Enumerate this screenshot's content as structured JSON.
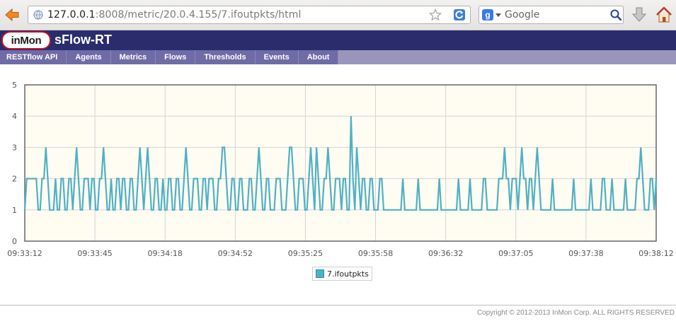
{
  "browser": {
    "url_host": "127.0.0.1",
    "url_rest": ":8008/metric/20.0.4.155/7.ifoutpkts/html",
    "search_placeholder": "Google",
    "icons": [
      "back-arrow-icon",
      "globe-icon",
      "star-icon",
      "reload-icon",
      "google-icon",
      "search-icon",
      "download-icon",
      "home-icon"
    ]
  },
  "app": {
    "logo_text": "inMon",
    "title": "sFlow-RT",
    "brand_color": "#2a2c6b",
    "logo_ring_color": "#c0102a"
  },
  "nav": {
    "tabs": [
      "RESTflow API",
      "Agents",
      "Metrics",
      "Flows",
      "Thresholds",
      "Events",
      "About"
    ]
  },
  "chart_data": {
    "type": "line",
    "title": "",
    "xlabel": "",
    "ylabel": "",
    "ylim": [
      0,
      5
    ],
    "yticks": [
      0,
      1,
      2,
      3,
      4,
      5
    ],
    "xticks": [
      "09:33:12",
      "09:33:45",
      "09:34:18",
      "09:34:52",
      "09:35:25",
      "09:35:58",
      "09:36:32",
      "09:37:05",
      "09:37:38",
      "09:38:12"
    ],
    "grid": true,
    "legend_position": "bottom",
    "plot_background": "#fffcf2",
    "series": [
      {
        "name": "7.ifoutpkts",
        "color": "#4fb1c4",
        "values": [
          1,
          2,
          2,
          2,
          2,
          2,
          2,
          1,
          1,
          2,
          2,
          3,
          2,
          1,
          1,
          1,
          2,
          1,
          1,
          2,
          2,
          1,
          1,
          2,
          2,
          1,
          2,
          3,
          2,
          1,
          1,
          2,
          2,
          2,
          1,
          2,
          2,
          1,
          1,
          2,
          2,
          3,
          2,
          1,
          1,
          2,
          1,
          1,
          2,
          2,
          1,
          2,
          2,
          1,
          1,
          2,
          2,
          1,
          1,
          2,
          3,
          2,
          1,
          2,
          3,
          2,
          1,
          1,
          2,
          2,
          1,
          1,
          2,
          1,
          1,
          2,
          2,
          1,
          1,
          2,
          2,
          1,
          1,
          2,
          3,
          2,
          1,
          1,
          2,
          2,
          2,
          1,
          1,
          2,
          2,
          1,
          2,
          2,
          2,
          1,
          1,
          2,
          2,
          3,
          3,
          2,
          1,
          1,
          2,
          2,
          1,
          1,
          2,
          2,
          1,
          1,
          1,
          2,
          2,
          1,
          1,
          2,
          3,
          2,
          1,
          1,
          2,
          2,
          1,
          1,
          1,
          2,
          2,
          2,
          1,
          1,
          1,
          2,
          3,
          3,
          2,
          1,
          1,
          2,
          2,
          2,
          1,
          1,
          2,
          3,
          2,
          1,
          3,
          2,
          1,
          1,
          2,
          2,
          3,
          2,
          1,
          1,
          2,
          2,
          2,
          1,
          2,
          2,
          1,
          1,
          4,
          2,
          1,
          3,
          2,
          1,
          2,
          2,
          1,
          1,
          2,
          2,
          1,
          1,
          1,
          2,
          2,
          1,
          1,
          1,
          1,
          1,
          1,
          1,
          1,
          1,
          1,
          2,
          1,
          1,
          1,
          1,
          1,
          1,
          1,
          2,
          1,
          1,
          1,
          1,
          1,
          1,
          1,
          1,
          1,
          1,
          2,
          1,
          1,
          1,
          1,
          1,
          1,
          1,
          1,
          1,
          2,
          1,
          1,
          1,
          1,
          1,
          2,
          1,
          1,
          1,
          1,
          1,
          1,
          2,
          2,
          1,
          1,
          1,
          1,
          1,
          1,
          2,
          2,
          2,
          3,
          2,
          2,
          1,
          2,
          2,
          2,
          1,
          2,
          3,
          2,
          2,
          1,
          2,
          2,
          1,
          2,
          3,
          2,
          1,
          1,
          1,
          1,
          1,
          1,
          2,
          1,
          1,
          1,
          1,
          1,
          1,
          1,
          1,
          1,
          1,
          2,
          1,
          1,
          1,
          1,
          1,
          1,
          1,
          1,
          2,
          1,
          1,
          1,
          1,
          1,
          2,
          2,
          1,
          1,
          1,
          2,
          1,
          1,
          1,
          1,
          1,
          1,
          2,
          1,
          1,
          1,
          1,
          1,
          2,
          2,
          3,
          2,
          1,
          1,
          1,
          2,
          2,
          1,
          2
        ]
      }
    ]
  },
  "footer": {
    "copyright": "Copyright © 2012-2013 InMon Corp. ALL RIGHTS RESERVED"
  }
}
